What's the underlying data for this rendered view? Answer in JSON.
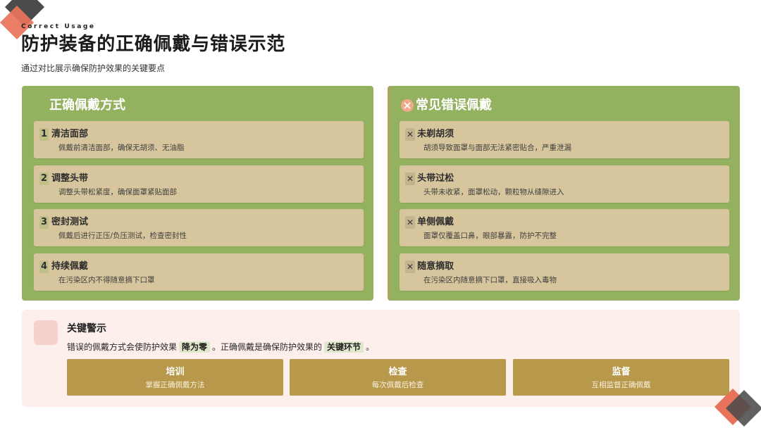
{
  "header": {
    "eyebrow": "Correct Usage",
    "title": "防护装备的正确佩戴与错误示范",
    "subtitle": "通过对比展示确保防护效果的关键要点"
  },
  "correct": {
    "heading": "正确佩戴方式",
    "items": [
      {
        "num": "1",
        "title": "清洁面部",
        "desc": "佩戴前清洁面部，确保无胡须、无油脂"
      },
      {
        "num": "2",
        "title": "调整头带",
        "desc": "调整头带松紧度，确保面罩紧贴面部"
      },
      {
        "num": "3",
        "title": "密封测试",
        "desc": "佩戴后进行正压/负压测试，检查密封性"
      },
      {
        "num": "4",
        "title": "持续佩戴",
        "desc": "在污染区内不得随意摘下口罩"
      }
    ]
  },
  "wrong": {
    "heading": "常见错误佩戴",
    "heading_icon": "x-circle-icon",
    "mark": "✕",
    "items": [
      {
        "title": "未剃胡须",
        "desc": "胡须导致面罩与面部无法紧密贴合，严重泄漏"
      },
      {
        "title": "头带过松",
        "desc": "头带未收紧，面罩松动，颗粒物从缝隙进入"
      },
      {
        "title": "单侧佩戴",
        "desc": "面罩仅覆盖口鼻，眼部暴露，防护不完整"
      },
      {
        "title": "随意摘取",
        "desc": "在污染区内随意摘下口罩，直接吸入毒物"
      }
    ]
  },
  "warning": {
    "heading": "关键警示",
    "icon": "warning-icon",
    "text_before": "错误的佩戴方式会使防护效果",
    "highlight1": "降为零",
    "text_mid": "。正确佩戴是确保防护效果的",
    "highlight2": "关键环节",
    "text_end": "。",
    "actions": [
      {
        "title": "培训",
        "desc": "掌握正确佩戴方法"
      },
      {
        "title": "检查",
        "desc": "每次佩戴后检查"
      },
      {
        "title": "监督",
        "desc": "互相监督正确佩戴"
      }
    ]
  },
  "colors": {
    "green": "#93b15f",
    "tan": "#d7c69d",
    "gold": "#b8994c",
    "warn-bg": "#fcefec",
    "coral": "#e8735a",
    "decor-gray": "#4b4b4b",
    "highlight": "#dfe8cc"
  }
}
